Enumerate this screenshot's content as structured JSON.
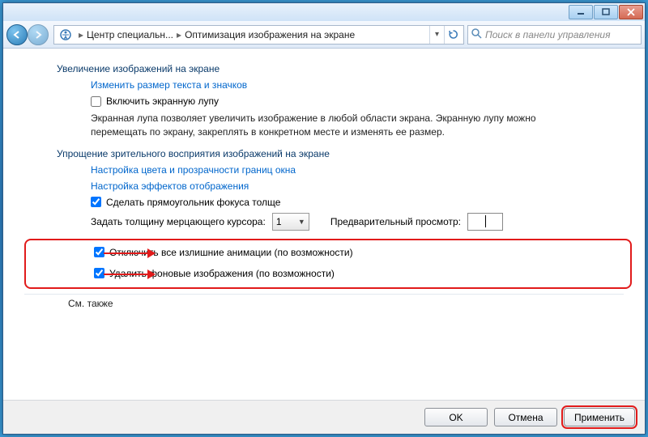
{
  "breadcrumb": {
    "item1": "Центр специальн...",
    "item2": "Оптимизация изображения на экране",
    "separator": "▸"
  },
  "search": {
    "placeholder": "Поиск в панели управления"
  },
  "section1": {
    "title": "Увеличение изображений на экране",
    "link": "Изменить размер текста и значков",
    "chk_magnifier": "Включить экранную лупу",
    "desc": "Экранная лупа позволяет увеличить изображение в любой области экрана. Экранную лупу можно перемещать по экрану, закреплять в конкретном месте и изменять ее размер."
  },
  "section2": {
    "title": "Упрощение зрительного восприятия изображений на экране",
    "link1": "Настройка цвета и прозрачности границ окна",
    "link2": "Настройка эффектов отображения",
    "chk_focus": "Сделать прямоугольник фокуса толще",
    "cursor_label": "Задать толщину мерцающего курсора:",
    "cursor_value": "1",
    "preview_label": "Предварительный просмотр:"
  },
  "highlight": {
    "chk_anim": "Отключить все излишние анимации (по возможности)",
    "chk_bg": "Удалить фоновые изображения (по возможности)"
  },
  "see_also": "См. также",
  "footer": {
    "ok": "OK",
    "cancel": "Отмена",
    "apply": "Применить"
  }
}
